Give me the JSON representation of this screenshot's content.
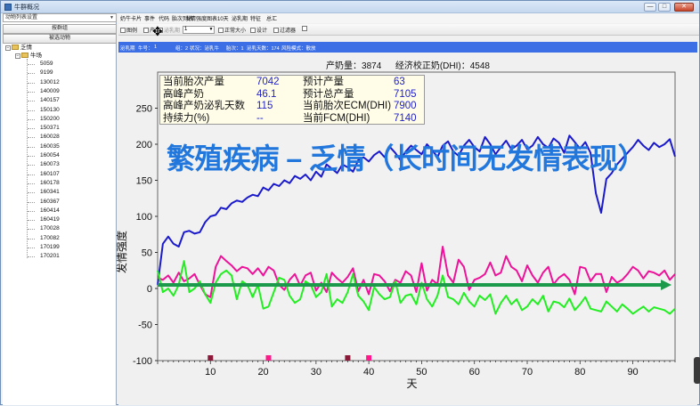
{
  "window": {
    "title": "牛群概况",
    "minimize": "—",
    "maximize": "□",
    "close": "✕"
  },
  "sidebar": {
    "filter_dropdown": "动物列表设置",
    "button_find": "按群组",
    "button_selected": "被选动物",
    "tree": {
      "root": "乏情",
      "group": "牛场",
      "animals": [
        "5059",
        "9199",
        "130012",
        "140009",
        "140157",
        "150130",
        "150200",
        "150371",
        "160028",
        "160035",
        "160054",
        "160073",
        "160107",
        "160178",
        "160341",
        "160367",
        "160414",
        "160419",
        "170028",
        "170082",
        "170199",
        "170201"
      ]
    }
  },
  "menubar": {
    "items": [
      "奶牛卡片",
      "事件",
      "代码",
      "胎次列表",
      "发情强度图表",
      "10天",
      "泌乳期",
      "特征",
      "总汇"
    ]
  },
  "toolbar": {
    "btn_chart": "图例",
    "btn_bar": "产",
    "label_lactation": "泌乳期",
    "lactation_value": "1",
    "btn_normal_size": "正常大小",
    "btn_design": "设计",
    "btn_filter": "过滤器"
  },
  "infobar": {
    "items": [
      "泌乳期",
      "牛号：",
      "1",
      "组：2",
      "状况：泌乳牛",
      "胎次：1",
      "泌乳天数：174",
      "风险模式：散放"
    ]
  },
  "chart_header": {
    "milk": "产奶量：3874",
    "dhi": "经济校正奶(DHI)：4548"
  },
  "kpi": {
    "rows": [
      {
        "l1": "当前胎次产量",
        "v1": "7042",
        "l2": "预计产量",
        "v2": "63"
      },
      {
        "l1": "高峰产奶",
        "v1": "46.1",
        "l2": "预计总产量",
        "v2": "7105"
      },
      {
        "l1": "高峰产奶泌乳天数",
        "v1": "115",
        "l2": "当前胎次ECM(DHI)",
        "v2": "7900"
      },
      {
        "l1": "持续力(%)",
        "v1": "--",
        "l2": "当前FCM(DHI)",
        "v2": "7140"
      }
    ]
  },
  "headline": "繁殖疾病 – 乏情（长时间无发情表现）",
  "chart_data": {
    "type": "line",
    "xlabel": "天",
    "ylabel": "发情强度",
    "xlim": [
      0,
      98
    ],
    "ylim": [
      -100,
      300
    ],
    "x_ticks": [
      10,
      20,
      30,
      40,
      50,
      60,
      70,
      80,
      90
    ],
    "y_ticks": [
      -100,
      -50,
      0,
      50,
      100,
      150,
      200,
      250
    ],
    "grid": false,
    "colors": {
      "blue": "#1a1acc",
      "magenta": "#ee1199",
      "green": "#22ee22",
      "arrow": "#1a9a4a",
      "marker_dark": "#8b1a3a",
      "marker_pink": "#ff1a8c"
    },
    "series": [
      {
        "color": "#1a1acc",
        "x": [
          0,
          1,
          2,
          3,
          4,
          5,
          6,
          7,
          8,
          9,
          10,
          11,
          12,
          13,
          14,
          15,
          16,
          17,
          18,
          19,
          20,
          21,
          22,
          23,
          24,
          25,
          26,
          27,
          28,
          29,
          30,
          31,
          32,
          33,
          34,
          35,
          36,
          37,
          38,
          39,
          40,
          41,
          42,
          43,
          44,
          45,
          46,
          47,
          48,
          49,
          50,
          51,
          52,
          53,
          54,
          55,
          56,
          57,
          58,
          59,
          60,
          61,
          62,
          63,
          64,
          65,
          66,
          67,
          68,
          69,
          70,
          71,
          72,
          73,
          74,
          75,
          76,
          77,
          78,
          79,
          80,
          81,
          82,
          83,
          84,
          85,
          86,
          87,
          88,
          89,
          90,
          91,
          92,
          93,
          94,
          95,
          96,
          97,
          98
        ],
        "values": [
          5,
          62,
          72,
          62,
          58,
          78,
          80,
          76,
          78,
          92,
          100,
          102,
          112,
          110,
          118,
          122,
          120,
          126,
          130,
          128,
          140,
          136,
          145,
          142,
          150,
          146,
          156,
          152,
          158,
          150,
          162,
          155,
          172,
          166,
          160,
          172,
          168,
          162,
          178,
          182,
          176,
          185,
          190,
          182,
          196,
          188,
          178,
          190,
          198,
          192,
          186,
          200,
          192,
          182,
          198,
          204,
          190,
          184,
          198,
          206,
          196,
          190,
          210,
          200,
          186,
          196,
          205,
          193,
          198,
          206,
          193,
          198,
          210,
          200,
          195,
          208,
          202,
          188,
          212,
          203,
          194,
          203,
          188,
          132,
          105,
          152,
          160,
          172,
          180,
          188,
          196,
          206,
          198,
          192,
          202,
          196,
          200,
          207,
          183
        ]
      },
      {
        "color": "#ee1199",
        "x": [
          0,
          1,
          2,
          3,
          4,
          5,
          6,
          7,
          8,
          9,
          10,
          11,
          12,
          13,
          14,
          15,
          16,
          17,
          18,
          19,
          20,
          21,
          22,
          23,
          24,
          25,
          26,
          27,
          28,
          29,
          30,
          31,
          32,
          33,
          34,
          35,
          36,
          37,
          38,
          39,
          40,
          41,
          42,
          43,
          44,
          45,
          46,
          47,
          48,
          49,
          50,
          51,
          52,
          53,
          54,
          55,
          56,
          57,
          58,
          59,
          60,
          61,
          62,
          63,
          64,
          65,
          66,
          67,
          68,
          69,
          70,
          71,
          72,
          73,
          74,
          75,
          76,
          77,
          78,
          79,
          80,
          81,
          82,
          83,
          84,
          85,
          86,
          87,
          88,
          89,
          90,
          91,
          92,
          93,
          94,
          95,
          96,
          97,
          98
        ],
        "values": [
          15,
          12,
          18,
          8,
          22,
          10,
          14,
          20,
          5,
          -8,
          -12,
          30,
          45,
          38,
          32,
          24,
          30,
          28,
          20,
          28,
          18,
          30,
          25,
          5,
          -2,
          12,
          20,
          4,
          18,
          22,
          -3,
          8,
          -5,
          22,
          14,
          8,
          16,
          28,
          -4,
          12,
          -8,
          20,
          18,
          10,
          -4,
          12,
          8,
          24,
          18,
          -5,
          35,
          -3,
          12,
          6,
          58,
          18,
          8,
          40,
          30,
          -2,
          12,
          15,
          20,
          36,
          18,
          22,
          45,
          30,
          25,
          10,
          32,
          18,
          8,
          22,
          30,
          6,
          15,
          20,
          12,
          -8,
          30,
          28,
          10,
          20,
          20,
          -5,
          16,
          8,
          12,
          20,
          30,
          25,
          14,
          24,
          22,
          18,
          25,
          12,
          20
        ]
      },
      {
        "color": "#22ee22",
        "x": [
          0,
          1,
          2,
          3,
          4,
          5,
          6,
          7,
          8,
          9,
          10,
          11,
          12,
          13,
          14,
          15,
          16,
          17,
          18,
          19,
          20,
          21,
          22,
          23,
          24,
          25,
          26,
          27,
          28,
          29,
          30,
          31,
          32,
          33,
          34,
          35,
          36,
          37,
          38,
          39,
          40,
          41,
          42,
          43,
          44,
          45,
          46,
          47,
          48,
          49,
          50,
          51,
          52,
          53,
          54,
          55,
          56,
          57,
          58,
          59,
          60,
          61,
          62,
          63,
          64,
          65,
          66,
          67,
          68,
          69,
          70,
          71,
          72,
          73,
          74,
          75,
          76,
          77,
          78,
          79,
          80,
          81,
          82,
          83,
          84,
          85,
          86,
          87,
          88,
          89,
          90,
          91,
          92,
          93,
          94,
          95,
          96,
          97,
          98
        ],
        "values": [
          25,
          -5,
          0,
          -10,
          5,
          38,
          -5,
          0,
          10,
          -8,
          -20,
          8,
          20,
          25,
          18,
          -15,
          10,
          5,
          -12,
          5,
          -28,
          -25,
          -5,
          15,
          12,
          -10,
          -20,
          -15,
          10,
          5,
          -12,
          -5,
          20,
          -25,
          -15,
          -20,
          -5,
          20,
          -10,
          -18,
          -30,
          2,
          -8,
          -15,
          -12,
          10,
          -20,
          -10,
          -8,
          -22,
          8,
          -15,
          -25,
          -10,
          18,
          -12,
          -15,
          -22,
          -6,
          -18,
          -25,
          -10,
          -16,
          -8,
          -35,
          -20,
          -10,
          -22,
          -15,
          -30,
          -25,
          -15,
          -22,
          -10,
          -32,
          -18,
          -20,
          -26,
          -14,
          -30,
          -22,
          -12,
          -28,
          -30,
          -32,
          -18,
          -25,
          -32,
          -22,
          -28,
          -35,
          -30,
          -25,
          -32,
          -26,
          -28,
          -30,
          -35,
          -28
        ]
      }
    ],
    "markers": [
      {
        "x": 10,
        "color": "#8b1a3a"
      },
      {
        "x": 21,
        "color": "#ff1a8c"
      },
      {
        "x": 36,
        "color": "#8b1a3a"
      },
      {
        "x": 40,
        "color": "#ff1a8c"
      }
    ],
    "arrow": {
      "from": [
        0,
        5
      ],
      "to": [
        97,
        5
      ]
    }
  }
}
